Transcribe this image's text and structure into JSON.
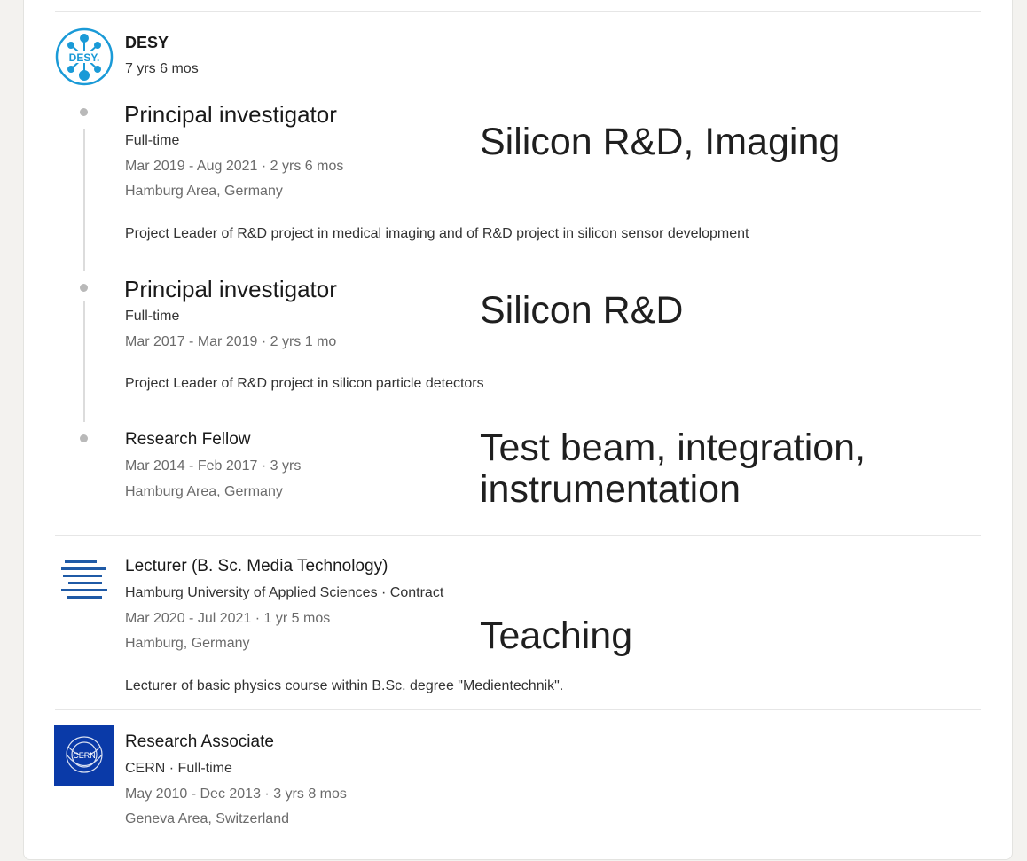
{
  "desy": {
    "company": "DESY",
    "tenure": "7 yrs 6 mos",
    "logo_icon": "desy-logo-icon",
    "logo_text": "DESY.",
    "roles": [
      {
        "title": "Principal investigator",
        "type": "Full-time",
        "dates": "Mar 2019 - Aug 2021 · 2 yrs 6 mos",
        "location": "Hamburg Area, Germany",
        "description": "Project Leader of R&D project in medical imaging and of R&D project in silicon sensor development",
        "annotation": "Silicon R&D, Imaging"
      },
      {
        "title": "Principal investigator",
        "type": "Full-time",
        "dates": "Mar 2017 - Mar 2019 · 2 yrs 1 mo",
        "description": "Project Leader of R&D project in silicon particle detectors",
        "annotation": "Silicon R&D"
      },
      {
        "title": "Research Fellow",
        "dates": "Mar 2014 - Feb 2017 · 3 yrs",
        "location": "Hamburg Area, Germany",
        "annotation_line1": "Test beam, integration,",
        "annotation_line2": "instrumentation"
      }
    ]
  },
  "haw": {
    "title": "Lecturer (B. Sc. Media Technology)",
    "org": "Hamburg University of Applied Sciences · Contract",
    "dates": "Mar 2020 - Jul 2021 · 1 yr 5 mos",
    "location": "Hamburg, Germany",
    "description": "Lecturer of basic physics course within B.Sc. degree \"Medientechnik\".",
    "annotation": "Teaching",
    "logo_icon": "haw-logo-icon"
  },
  "cern": {
    "title": "Research Associate",
    "org": "CERN · Full-time",
    "dates": "May 2010 - Dec 2013 · 3 yrs 8 mos",
    "location": "Geneva Area, Switzerland",
    "logo_icon": "cern-logo-icon",
    "logo_text": "CERN"
  },
  "colors": {
    "desy_blue": "#1a9ad7",
    "haw_blue": "#1f5aa6",
    "cern_blue": "#0a3aa8",
    "meta_gray": "#6b6b6b"
  }
}
